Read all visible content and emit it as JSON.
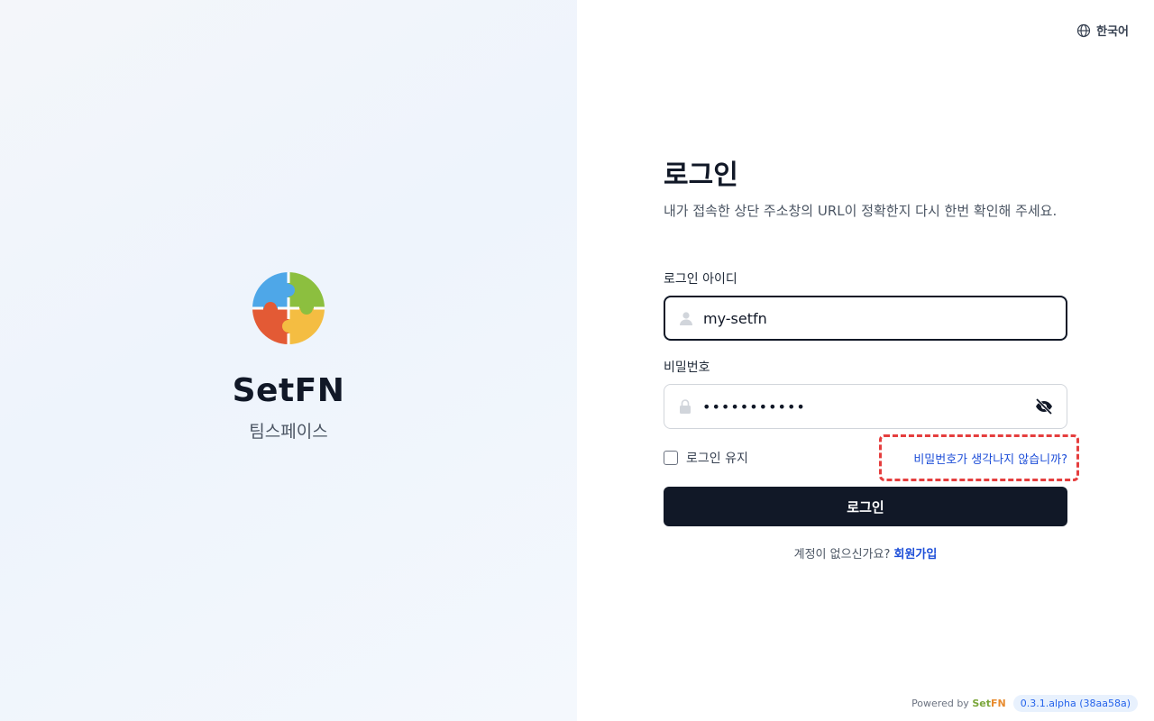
{
  "brand": {
    "name": "SetFN",
    "subtitle": "팀스페이스"
  },
  "header": {
    "language": "한국어",
    "language_icon": "globe-icon"
  },
  "login": {
    "title": "로그인",
    "description": "내가 접속한 상단 주소창의 URL이 정확한지 다시 한번 확인해 주세요.",
    "id_label": "로그인 아이디",
    "id_value": "my-setfn",
    "password_label": "비밀번호",
    "password_value": "***********",
    "remember_label": "로그인 유지",
    "remember_checked": false,
    "forgot_label": "비밀번호가 생각나지 않습니까?",
    "submit_label": "로그인",
    "signup_prompt": "계정이 없으신가요?",
    "signup_link": "회원가입"
  },
  "footer": {
    "powered_by": "Powered by",
    "brand_set": "Set",
    "brand_fn": "FN",
    "version": "0.3.1.alpha (38aa58a)"
  },
  "colors": {
    "primary_button": "#111827",
    "link": "#1d4ed8",
    "highlight_border": "#e53e3e",
    "logo_blue": "#4ea7e8",
    "logo_green": "#8cbf3f",
    "logo_red": "#e35a35",
    "logo_yellow": "#f4bd42"
  }
}
